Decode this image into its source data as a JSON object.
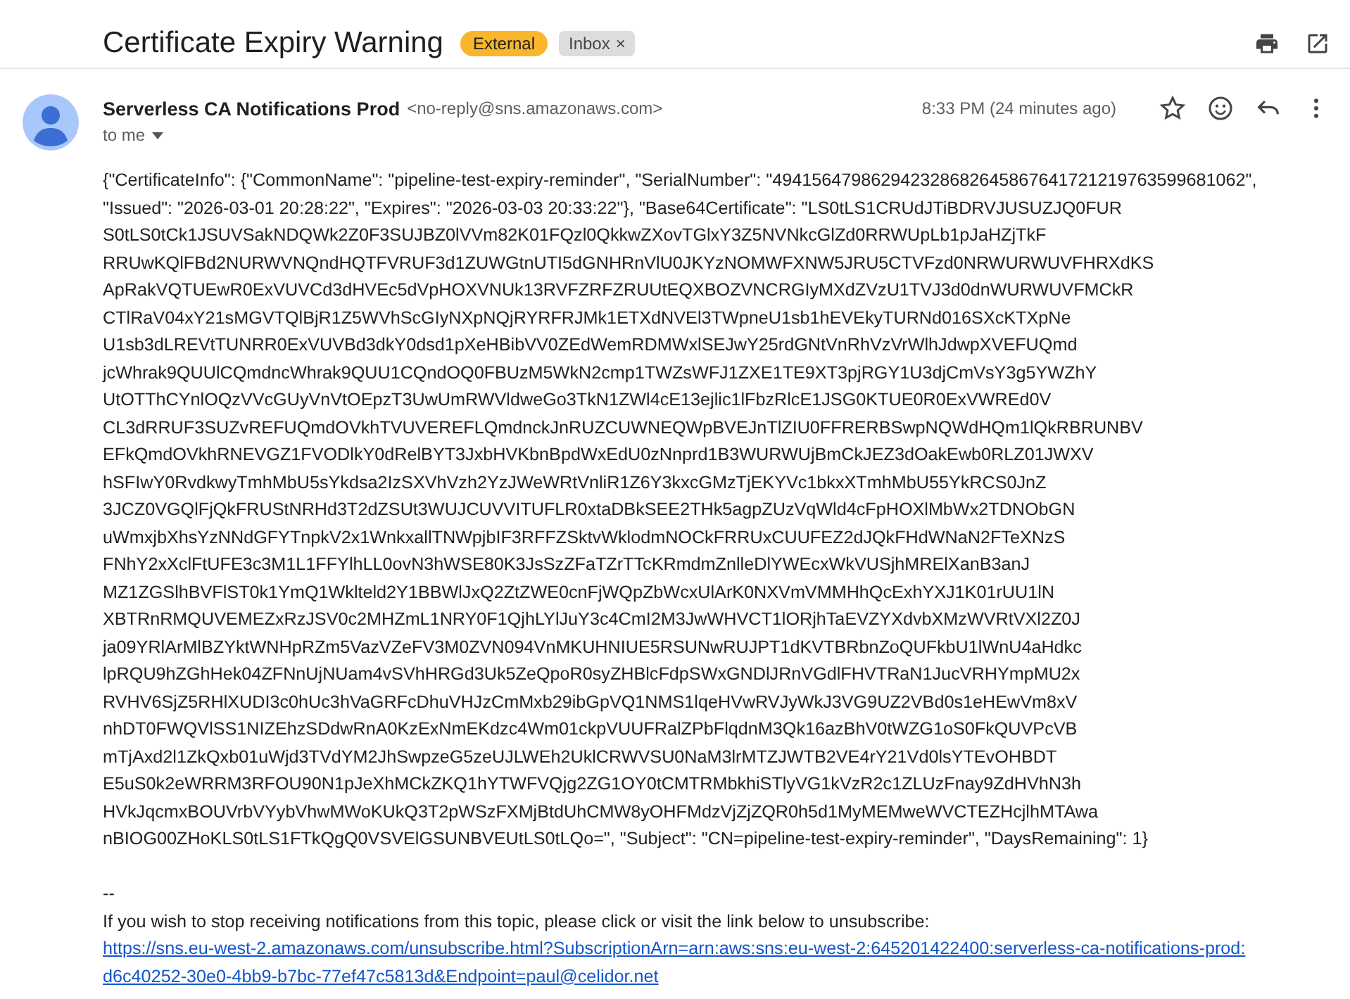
{
  "subject": "Certificate Expiry Warning",
  "labels": [
    {
      "kind": "external",
      "text": "External"
    },
    {
      "kind": "inbox",
      "text": "Inbox",
      "close": "×"
    }
  ],
  "sender": {
    "name": "Serverless CA Notifications Prod",
    "email": "<no-reply@sns.amazonaws.com>",
    "to": "to me",
    "time": "8:33 PM (24 minutes ago)"
  },
  "body_lines": [
    "{\"CertificateInfo\": {\"CommonName\": \"pipeline-test-expiry-reminder\", \"SerialNumber\": \"494156479862942328682645867641721219763599681062\",",
    "\"Issued\": \"2026-03-01 20:28:22\", \"Expires\": \"2026-03-03 20:33:22\"}, \"Base64Certificate\": \"LS0tLS1CRUdJTiBDRVJUSUZJQ0FUR",
    "S0tLS0tCk1JSUVSakNDQWk2Z0F3SUJBZ0lVVm82K01FQzl0QkkwZXovTGlxY3Z5NVNkcGlZd0RRWUpLb1pJaHZjTkF",
    "RRUwKQlFBd2NURWVNQndHQTFVRUF3d1ZUWGtnUTI5dGNHRnVlU0JKYzNOMWFXNW5JRU5CTVFzd0NRWURWUVFHRXdKS",
    "ApRakVQTUEwR0ExVUVCd3dHVEc5dVpHOXVNUk13RVFZRFZRUUtEQXBOZVNCRGIyMXdZVzU1TVJ3d0dnWURWUVFMCkR",
    "CTlRaV04xY21sMGVTQlBjR1Z5WVhScGIyNXpNQjRYRFRJMk1ETXdNVEl3TWpneU1sb1hEVEkyTURNd016SXcKTXpNe",
    "U1sb3dLREVtTUNRR0ExVUVBd3dkY0dsd1pXeHBibVV0ZEdWemRDMWxlSEJwY25rdGNtVnRhVzVrWlhJdwpXVEFUQmd",
    "jcWhrak9QUUlCQmdncWhrak9QUU1CQndOQ0FBUzM5WkN2cmp1TWZsWFJ1ZXE1TE9XT3pjRGY1U3djCmVsY3g5YWZhY",
    "UtOTThCYnlOQzVVcGUyVnVtOEpzT3UwUmRWVldweGo3TkN1ZWl4cE13ejlic1lFbzRlcE1JSG0KTUE0R0ExVWREd0V",
    "CL3dRRUF3SUZvREFUQmdOVkhTVUVEREFLQmdnckJnRUZCUWNEQWpBVEJnTlZIU0FFRERBSwpNQWdHQm1lQkRBRUNBV",
    "EFkQmdOVkhRNEVGZ1FVODlkY0dRelBYT3JxbHVKbnBpdWxEdU0zNnprd1B3WURWUjBmCkJEZ3dOakEwb0RLZ01JWXV",
    "hSFIwY0RvdkwyTmhMbU5sYkdsa2IzSXVhVzh2YzJWeWRtVnliR1Z6Y3kxcGMzTjEKYVc1bkxXTmhMbU55YkRCS0JnZ",
    "3JCZ0VGQlFjQkFRUStNRHd3T2dZSUt3WUJCUVVITUFLR0xtaDBkSEE2THk5agpZUzVqWld4cFpHOXlMbWx2TDNObGN",
    "uWmxjbXhsYzNNdGFYTnpkV2x1WnkxallTNWpjbIF3RFFZSktvWklodmNOCkFRRUxCUUFEZ2dJQkFHdWNaN2FTeXNzS",
    "FNhY2xXclFtUFE3c3M1L1FFYlhLL0ovN3hWSE80K3JsSzZFaTZrTTcKRmdmZnlleDlYWEcxWkVUSjhMRElXanB3anJ",
    "MZ1ZGSlhBVFlST0k1YmQ1Wklteld2Y1BBWlJxQ2ZtZWE0cnFjWQpZbWcxUlArK0NXVmVMMHhQcExhYXJ1K01rUU1lN",
    "XBTRnRMQUVEMEZxRzJSV0c2MHZmL1NRY0F1QjhLYlJuY3c4CmI2M3JwWHVCT1lORjhTaEVZYXdvbXMzWVRtVXl2Z0J",
    "ja09YRlArMlBZYktWNHpRZm5VazVZeFV3M0ZVN094VnMKUHNIUE5RSUNwRUJPT1dKVTBRbnZoQUFkbU1lWnU4aHdkc",
    "lpRQU9hZGhHek04ZFNnUjNUam4vSVhHRGd3Uk5ZeQpoR0syZHBlcFdpSWxGNDlJRnVGdlFHVTRaN1JucVRHYmpMU2x",
    "RVHV6SjZ5RHlXUDI3c0hUc3hVaGRFcDhuVHJzCmMxb29ibGpVQ1NMS1lqeHVwRVJyWkJ3VG9UZ2VBd0s1eHEwVm8xV",
    "nhDT0FWQVlSS1NIZEhzSDdwRnA0KzExNmEKdzc4Wm01ckpVUUFRalZPbFlqdnM3Qk16azBhV0tWZG1oS0FkQUVPcVB",
    "mTjAxd2l1ZkQxb01uWjd3TVdYM2JhSwpzeG5zeUJLWEh2UklCRWVSU0NaM3lrMTZJWTB2VE4rY21Vd0lsYTEvOHBDT",
    "E5uS0k2eWRRM3RFOU90N1pJeXhMCkZKQ1hYTWFVQjg2ZG1OY0tCMTRMbkhiSTlyVG1kVzR2c1ZLUzFnay9ZdHVhN3h",
    "HVkJqcmxBOUVrbVYybVhwMWoKUkQ3T2pWSzFXMjBtdUhCMW8yOHFMdzVjZjZQR0h5d1MyMEMweWVCTEZHcjlhMTAwa",
    "nBIOG00ZHoKLS0tLS1FTkQgQ0VSVElGSUNBVEUtLS0tLQo=\", \"Subject\": \"CN=pipeline-test-expiry-reminder\", \"DaysRemaining\": 1}"
  ],
  "signature_separator": "--",
  "unsubscribe_text": "If you wish to stop receiving notifications from this topic, please click or visit the link below to unsubscribe:",
  "unsubscribe_link_lines": [
    "https://sns.eu-west-2.amazonaws.com/unsubscribe.html?SubscriptionArn=arn:aws:sns:eu-west-2:645201422400:serverless-ca-notifications-prod:",
    "d6c40252-30e0-4bb9-b7bc-77ef47c5813d&Endpoint=paul@celidor.net"
  ]
}
